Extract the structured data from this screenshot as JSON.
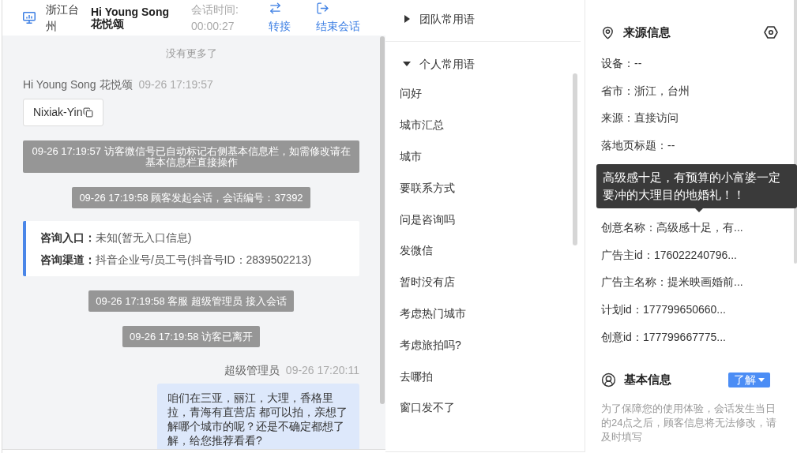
{
  "chat_header": {
    "location": "浙江台州",
    "visitor_name": "Hi Young Song 花悦颂",
    "session_time_label": "会话时间:",
    "session_time": "00:00:27",
    "actions": [
      {
        "label": "转接",
        "kind": "transfer"
      },
      {
        "label": "结束会话",
        "kind": "end"
      }
    ]
  },
  "chat": {
    "top_notice": "没有更多了",
    "messages": [
      {
        "kind": "incoming",
        "sender": "Hi Young Song 花悦颂",
        "time": "09-26 17:19:57",
        "text": "Nixiak-Yin"
      },
      {
        "kind": "system",
        "text": "09-26 17:19:57 访客微信号已自动标记右侧基本信息栏，如需修改请在基本信息栏直接操作"
      },
      {
        "kind": "system",
        "text": "09-26 17:19:58 顾客发起会话，会话编号：37392"
      },
      {
        "kind": "info",
        "rows": [
          {
            "label": "咨询入口：",
            "value": "未知(暂无入口信息)"
          },
          {
            "label": "咨询渠道：",
            "value": "抖音企业号/员工号(抖音号ID：2839502213)"
          }
        ]
      },
      {
        "kind": "system",
        "text": "09-26 17:19:58 客服 超级管理员 接入会话"
      },
      {
        "kind": "system",
        "text": "09-26 17:19:58 访客已离开"
      },
      {
        "kind": "outgoing",
        "sender": "超级管理员",
        "time": "09-26 17:20:11",
        "text": "咱们在三亚，丽江，大理，香格里拉，青海有直营店 都可以拍，亲想了解哪个城市的呢？还是不确定都想了解，给您推荐看看?"
      }
    ]
  },
  "phrases": {
    "groups": [
      {
        "label": "团队常用语",
        "expanded": false
      },
      {
        "label": "个人常用语",
        "expanded": true,
        "items": [
          "问好",
          "城市汇总",
          "城市",
          "要联系方式",
          "问是咨询吗",
          "发微信",
          "暂时没有店",
          "考虑热门城市",
          "考虑旅拍吗?",
          "去哪拍",
          "窗口发不了"
        ]
      }
    ]
  },
  "source_info": {
    "title": "来源信息",
    "items": [
      {
        "kind": "row",
        "text": "设备：--"
      },
      {
        "kind": "row",
        "text": "省市：浙江，台州"
      },
      {
        "kind": "row",
        "text": "来源：直接访问"
      },
      {
        "kind": "row",
        "text": "落地页标题：--"
      },
      {
        "kind": "tooltip",
        "text": "高级感十足，有预算的小富婆一定要冲的大理目的地婚礼！！"
      },
      {
        "kind": "row",
        "text": "创意名称：高级感十足，有..."
      },
      {
        "kind": "row",
        "text": "广告主id：176022240796..."
      },
      {
        "kind": "row",
        "text": "广告主名称：提米映画婚前..."
      },
      {
        "kind": "row",
        "text": "计划id：177799650660..."
      },
      {
        "kind": "row",
        "text": "创意id：177799667775..."
      }
    ]
  },
  "basic_info": {
    "title": "基本信息",
    "button": "了解",
    "note": "为了保障您的使用体验，会话发生当日的24点之后，顾客信息将无法修改，请及时填写"
  }
}
